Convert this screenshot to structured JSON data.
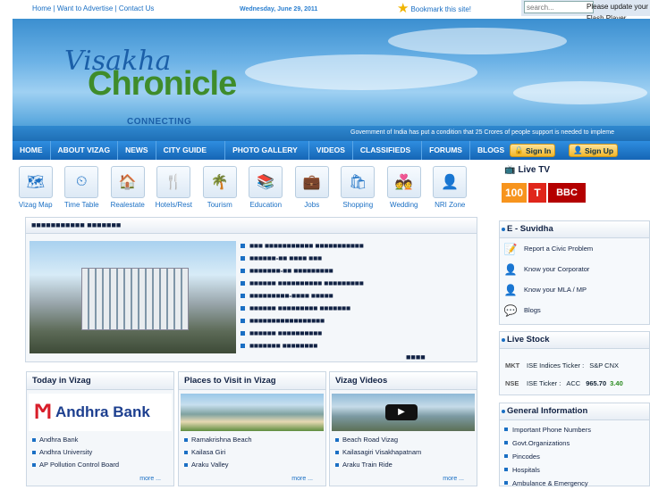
{
  "top": {
    "links": [
      "Home",
      "Want to Advertise",
      "Contact Us"
    ],
    "date": "Wednesday, June 29, 2011",
    "bookmark": "Bookmark this site!",
    "search_placeholder": "search...",
    "flash": "Please update your Flash Player"
  },
  "header": {
    "logo_line1": "Visakha",
    "logo_line2": "Chronicle",
    "logo_tagline": "CONNECTING VIZAGITES",
    "ticker": "Government of India has put a condition that 25 Crores of people support is needed to impleme"
  },
  "nav": {
    "items": [
      "HOME",
      "ABOUT VIZAG",
      "NEWS",
      "CITY GUIDE",
      "PHOTO GALLERY",
      "VIDEOS",
      "CLASSIFIEDS",
      "FORUMS",
      "BLOGS"
    ],
    "sign_in": "Sign In",
    "sign_up": "Sign Up"
  },
  "categories": [
    {
      "label": "Vizag Map",
      "icon": "map-icon",
      "glyph": "🗺"
    },
    {
      "label": "Time Table",
      "icon": "clock-icon",
      "glyph": "⏲"
    },
    {
      "label": "Realestate",
      "icon": "house-icon",
      "glyph": "🏠"
    },
    {
      "label": "Hotels/Rest",
      "icon": "restaurant-icon",
      "glyph": "🍴"
    },
    {
      "label": "Tourism",
      "icon": "palm-icon",
      "glyph": "🌴"
    },
    {
      "label": "Education",
      "icon": "books-icon",
      "glyph": "📚"
    },
    {
      "label": "Jobs",
      "icon": "briefcase-icon",
      "glyph": "💼"
    },
    {
      "label": "Shopping",
      "icon": "bag-icon",
      "glyph": "🛍"
    },
    {
      "label": "Wedding",
      "icon": "couple-icon",
      "glyph": "💑"
    },
    {
      "label": "NRI Zone",
      "icon": "person-icon",
      "glyph": "👤"
    }
  ],
  "news": {
    "title": "■■■■■■■■■■■ ■■■■■■■",
    "items": [
      "■■■ ■■■■■■■■■■■ ■■■■■■■■■■■",
      "■■■■■■-■■ ■■■■ ■■■",
      "■■■■■■■-■■ ■■■■■■■■■",
      "■■■■■■ ■■■■■■■■■■ ■■■■■■■■■",
      "■■■■■■■■■-■■■■ ■■■■■",
      "■■■■■■ ■■■■■■■■■ ■■■■■■■",
      "■■■■■■■■■■■■■■■■■",
      "■■■■■■ ■■■■■■■■■■",
      "■■■■■■■ ■■■■■■■■"
    ],
    "pager": "■■■■"
  },
  "today": {
    "title": "Today in Vizag",
    "banner": "Andhra Bank",
    "items": [
      "Andhra Bank",
      "Andhra University",
      "AP Pollution Control Board"
    ],
    "more": "more ..."
  },
  "places": {
    "title": "Places to Visit in Vizag",
    "items": [
      "Ramakrishna Beach",
      "Kailasa Giri",
      "Araku Valley"
    ],
    "more": "more ..."
  },
  "videos": {
    "title": "Vizag Videos",
    "items": [
      "Beach Road Vizag",
      "Kailasagiri Visakhapatnam",
      "Araku Train Ride"
    ],
    "more": "more ..."
  },
  "livetv": {
    "title": "Live TV",
    "channels": [
      "100",
      "T",
      "BBC"
    ]
  },
  "esuvidha": {
    "title": "E - Suvidha",
    "items": [
      "Report a Civic Problem",
      "Know your Corporator",
      "Know your MLA / MP",
      "Blogs"
    ]
  },
  "stock": {
    "title": "Live Stock",
    "rows": [
      {
        "ex": "MKT",
        "text": "ISE Indices Ticker :",
        "idx": "S&P CNX"
      },
      {
        "ex": "NSE",
        "text": "ISE Ticker :",
        "idx": "ACC",
        "price": "965.70",
        "chg": "3.40"
      }
    ]
  },
  "general": {
    "title": "General Information",
    "items": [
      "Important Phone Numbers",
      "Govt.Organizations",
      "Pincodes",
      "Hospitals",
      "Ambulance & Emergency"
    ]
  },
  "colors": {
    "nav": "#1f77c8",
    "accent": "#1a6fc4",
    "logo_green": "#3f8c2b"
  }
}
